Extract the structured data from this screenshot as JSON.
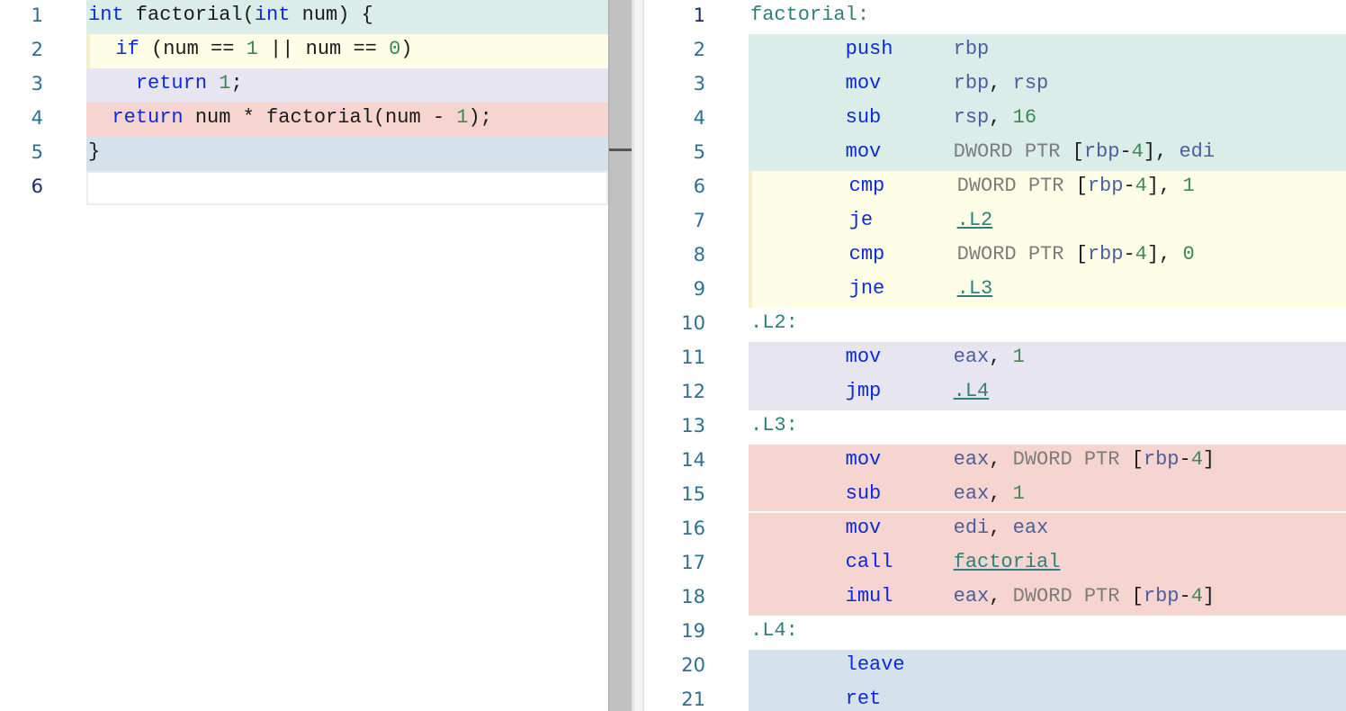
{
  "source": {
    "lines": [
      {
        "n": "1",
        "tokens": [
          {
            "t": "int",
            "c": "kw"
          },
          {
            "t": " factorial(",
            "c": "punc"
          },
          {
            "t": "int",
            "c": "kw"
          },
          {
            "t": " num) {",
            "c": "punc"
          }
        ],
        "bg": "teal"
      },
      {
        "n": "2",
        "tokens": [
          {
            "t": "  ",
            "c": "punc"
          },
          {
            "t": "if",
            "c": "kw"
          },
          {
            "t": " (num == ",
            "c": "punc"
          },
          {
            "t": "1",
            "c": "num"
          },
          {
            "t": " || num == ",
            "c": "punc"
          },
          {
            "t": "0",
            "c": "num"
          },
          {
            "t": ")",
            "c": "punc"
          }
        ],
        "bg": "yellow"
      },
      {
        "n": "3",
        "tokens": [
          {
            "t": "    ",
            "c": "punc"
          },
          {
            "t": "return",
            "c": "kw"
          },
          {
            "t": " ",
            "c": "punc"
          },
          {
            "t": "1",
            "c": "num"
          },
          {
            "t": ";",
            "c": "punc"
          }
        ],
        "bg": "lav"
      },
      {
        "n": "4",
        "tokens": [
          {
            "t": "  ",
            "c": "punc"
          },
          {
            "t": "return",
            "c": "kw"
          },
          {
            "t": " num * factorial(num - ",
            "c": "punc"
          },
          {
            "t": "1",
            "c": "num"
          },
          {
            "t": ");",
            "c": "punc"
          }
        ],
        "bg": "pink"
      },
      {
        "n": "5",
        "tokens": [
          {
            "t": "}",
            "c": "punc"
          }
        ],
        "bg": "blue"
      },
      {
        "n": "6",
        "tokens": [],
        "bg": "empty",
        "current": true
      }
    ]
  },
  "assembly": {
    "lines": [
      {
        "n": "1",
        "label": "factorial:",
        "bg": "none",
        "current": true
      },
      {
        "n": "2",
        "mnemonic": "push",
        "operands": [
          {
            "t": "rbp",
            "c": "reg"
          }
        ],
        "bg": "teal"
      },
      {
        "n": "3",
        "mnemonic": "mov",
        "operands": [
          {
            "t": "rbp",
            "c": "reg"
          },
          {
            "t": ", ",
            "c": "punc"
          },
          {
            "t": "rsp",
            "c": "reg"
          }
        ],
        "bg": "teal"
      },
      {
        "n": "4",
        "mnemonic": "sub",
        "operands": [
          {
            "t": "rsp",
            "c": "reg"
          },
          {
            "t": ", ",
            "c": "punc"
          },
          {
            "t": "16",
            "c": "num"
          }
        ],
        "bg": "teal"
      },
      {
        "n": "5",
        "mnemonic": "mov",
        "operands": [
          {
            "t": "DWORD PTR ",
            "c": "ptr"
          },
          {
            "t": "[",
            "c": "punc"
          },
          {
            "t": "rbp",
            "c": "reg"
          },
          {
            "t": "-",
            "c": "punc"
          },
          {
            "t": "4",
            "c": "num"
          },
          {
            "t": "], ",
            "c": "punc"
          },
          {
            "t": "edi",
            "c": "reg"
          }
        ],
        "bg": "teal"
      },
      {
        "n": "6",
        "mnemonic": "cmp",
        "operands": [
          {
            "t": "DWORD PTR ",
            "c": "ptr"
          },
          {
            "t": "[",
            "c": "punc"
          },
          {
            "t": "rbp",
            "c": "reg"
          },
          {
            "t": "-",
            "c": "punc"
          },
          {
            "t": "4",
            "c": "num"
          },
          {
            "t": "], ",
            "c": "punc"
          },
          {
            "t": "1",
            "c": "num"
          }
        ],
        "bg": "yellow"
      },
      {
        "n": "7",
        "mnemonic": "je",
        "operands": [
          {
            "t": ".L2",
            "c": "link"
          }
        ],
        "bg": "yellow"
      },
      {
        "n": "8",
        "mnemonic": "cmp",
        "operands": [
          {
            "t": "DWORD PTR ",
            "c": "ptr"
          },
          {
            "t": "[",
            "c": "punc"
          },
          {
            "t": "rbp",
            "c": "reg"
          },
          {
            "t": "-",
            "c": "punc"
          },
          {
            "t": "4",
            "c": "num"
          },
          {
            "t": "], ",
            "c": "punc"
          },
          {
            "t": "0",
            "c": "num"
          }
        ],
        "bg": "yellow"
      },
      {
        "n": "9",
        "mnemonic": "jne",
        "operands": [
          {
            "t": ".L3",
            "c": "link"
          }
        ],
        "bg": "yellow"
      },
      {
        "n": "10",
        "label": ".L2:",
        "bg": "none"
      },
      {
        "n": "11",
        "mnemonic": "mov",
        "operands": [
          {
            "t": "eax",
            "c": "reg"
          },
          {
            "t": ", ",
            "c": "punc"
          },
          {
            "t": "1",
            "c": "num"
          }
        ],
        "bg": "lav"
      },
      {
        "n": "12",
        "mnemonic": "jmp",
        "operands": [
          {
            "t": ".L4",
            "c": "link"
          }
        ],
        "bg": "lav"
      },
      {
        "n": "13",
        "label": ".L3:",
        "bg": "none"
      },
      {
        "n": "14",
        "mnemonic": "mov",
        "operands": [
          {
            "t": "eax",
            "c": "reg"
          },
          {
            "t": ", ",
            "c": "punc"
          },
          {
            "t": "DWORD PTR ",
            "c": "ptr"
          },
          {
            "t": "[",
            "c": "punc"
          },
          {
            "t": "rbp",
            "c": "reg"
          },
          {
            "t": "-",
            "c": "punc"
          },
          {
            "t": "4",
            "c": "num"
          },
          {
            "t": "]",
            "c": "punc"
          }
        ],
        "bg": "pink"
      },
      {
        "n": "15",
        "mnemonic": "sub",
        "operands": [
          {
            "t": "eax",
            "c": "reg"
          },
          {
            "t": ", ",
            "c": "punc"
          },
          {
            "t": "1",
            "c": "num"
          }
        ],
        "bg": "pink",
        "sep": true
      },
      {
        "n": "16",
        "mnemonic": "mov",
        "operands": [
          {
            "t": "edi",
            "c": "reg"
          },
          {
            "t": ", ",
            "c": "punc"
          },
          {
            "t": "eax",
            "c": "reg"
          }
        ],
        "bg": "pink"
      },
      {
        "n": "17",
        "mnemonic": "call",
        "operands": [
          {
            "t": "factorial",
            "c": "link"
          }
        ],
        "bg": "pink"
      },
      {
        "n": "18",
        "mnemonic": "imul",
        "operands": [
          {
            "t": "eax",
            "c": "reg"
          },
          {
            "t": ", ",
            "c": "punc"
          },
          {
            "t": "DWORD PTR ",
            "c": "ptr"
          },
          {
            "t": "[",
            "c": "punc"
          },
          {
            "t": "rbp",
            "c": "reg"
          },
          {
            "t": "-",
            "c": "punc"
          },
          {
            "t": "4",
            "c": "num"
          },
          {
            "t": "]",
            "c": "punc"
          }
        ],
        "bg": "pink"
      },
      {
        "n": "19",
        "label": ".L4:",
        "bg": "none"
      },
      {
        "n": "20",
        "mnemonic": "leave",
        "operands": [],
        "bg": "blue"
      },
      {
        "n": "21",
        "mnemonic": "ret",
        "operands": [],
        "bg": "blue"
      }
    ]
  },
  "colors": {
    "teal": "#dbede9",
    "yellow": "#fefee6",
    "lav": "#e7e5f0",
    "pink": "#f6d4cf",
    "blue": "#d5e1eb",
    "keyword": "#0b2ad8",
    "number": "#3a8a56",
    "register": "#4a5f9c",
    "label": "#2f7f7a"
  }
}
